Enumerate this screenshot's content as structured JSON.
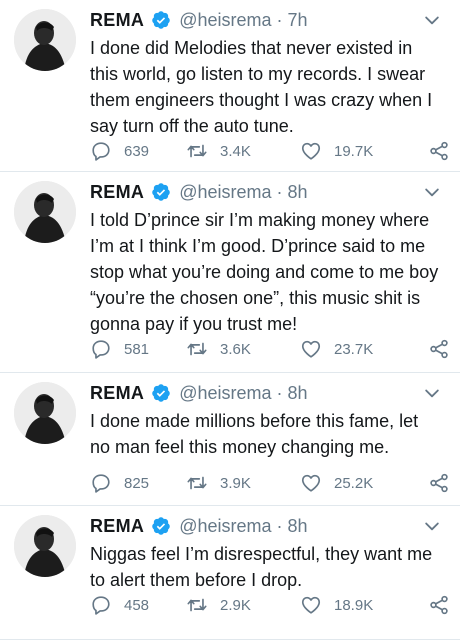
{
  "tweets": [
    {
      "name": "REMA",
      "handle": "@heisrema",
      "separator": "·",
      "time": "7h",
      "lines": [
        "I done did Melodies that never existed in",
        "this world, go listen to my records. I swear",
        "them engineers thought I was crazy when I",
        "say turn off the auto tune."
      ],
      "replies": "639",
      "retweets": "3.4K",
      "likes": "19.7K"
    },
    {
      "name": "REMA",
      "handle": "@heisrema",
      "separator": "·",
      "time": "8h",
      "lines": [
        "I told D’prince sir I’m making money where",
        "I’m at I think I’m good. D’prince said to me",
        "stop what you’re doing and come to me boy",
        "“you’re the chosen one”, this music shit is",
        "gonna pay if you trust me!"
      ],
      "replies": "581",
      "retweets": "3.6K",
      "likes": "23.7K"
    },
    {
      "name": "REMA",
      "handle": "@heisrema",
      "separator": "·",
      "time": "8h",
      "lines": [
        "I done made millions before this fame, let",
        "no man feel this money changing me."
      ],
      "replies": "825",
      "retweets": "3.9K",
      "likes": "25.2K"
    },
    {
      "name": "REMA",
      "handle": "@heisrema",
      "separator": "·",
      "time": "8h",
      "lines": [
        "Niggas feel I’m disrespectful, they want me",
        "to alert them before I drop."
      ],
      "replies": "458",
      "retweets": "2.9K",
      "likes": "18.9K"
    }
  ],
  "icons": {
    "verified": "verified-badge-icon",
    "caret": "chevron-down-icon",
    "reply": "reply-icon",
    "retweet": "retweet-icon",
    "like": "heart-icon",
    "share": "share-icon"
  },
  "colors": {
    "verified": "#1da1f2",
    "secondary_text": "#657786",
    "divider": "#e1e8ed"
  }
}
